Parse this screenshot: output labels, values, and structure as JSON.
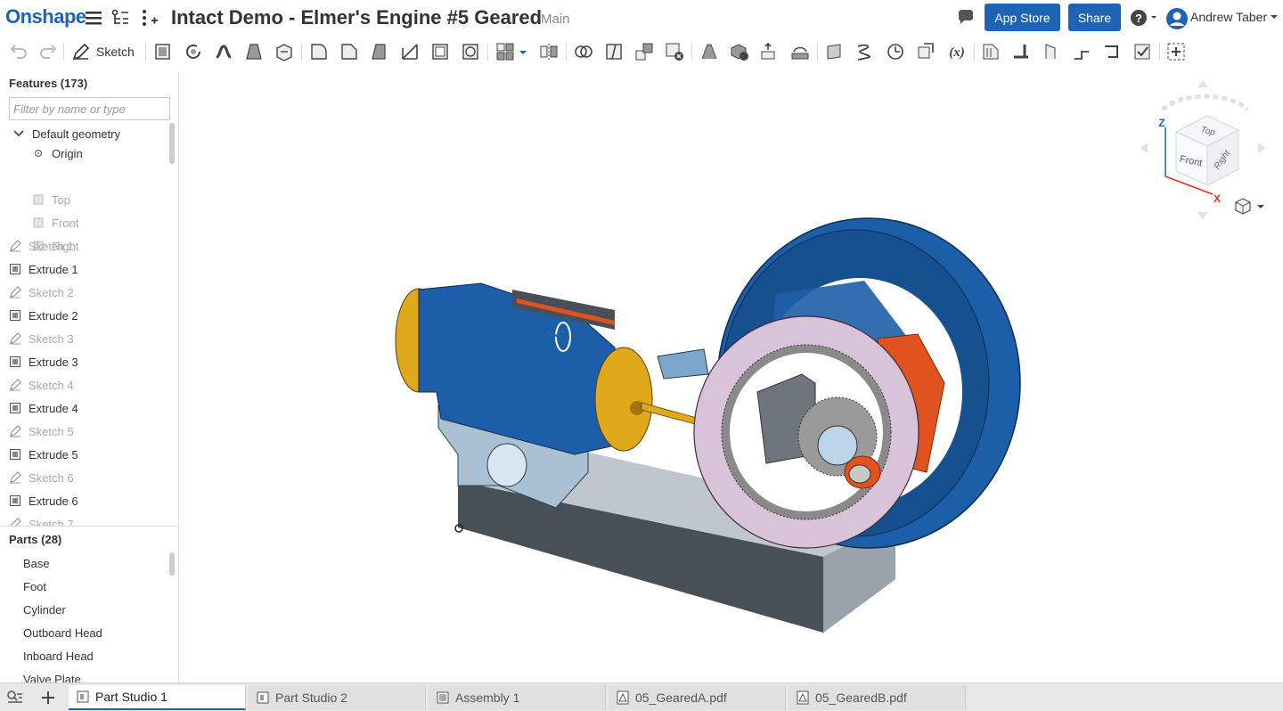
{
  "app": {
    "logo": "Onshape"
  },
  "header": {
    "title": "Intact Demo - Elmer's Engine #5 Geared",
    "branch": "Main",
    "app_store_label": "App Store",
    "share_label": "Share",
    "user_name": "Andrew Taber"
  },
  "toolbar": {
    "sketch_label": "Sketch"
  },
  "features": {
    "heading": "Features (173)",
    "filter_placeholder": "Filter by name or type",
    "items": [
      {
        "label": "Default geometry",
        "type": "group"
      },
      {
        "label": "Origin",
        "type": "origin"
      },
      {
        "label": "Top",
        "type": "plane"
      },
      {
        "label": "Front",
        "type": "plane"
      },
      {
        "label": "Right",
        "type": "plane"
      },
      {
        "label": "Sketch 1",
        "type": "sketch"
      },
      {
        "label": "Extrude 1",
        "type": "extrude"
      },
      {
        "label": "Sketch 2",
        "type": "sketch"
      },
      {
        "label": "Extrude 2",
        "type": "extrude"
      },
      {
        "label": "Sketch 3",
        "type": "sketch"
      },
      {
        "label": "Extrude 3",
        "type": "extrude"
      },
      {
        "label": "Sketch 4",
        "type": "sketch"
      },
      {
        "label": "Extrude 4",
        "type": "extrude"
      },
      {
        "label": "Sketch 5",
        "type": "sketch"
      },
      {
        "label": "Extrude 5",
        "type": "extrude"
      },
      {
        "label": "Sketch 6",
        "type": "sketch"
      },
      {
        "label": "Extrude 6",
        "type": "extrude"
      },
      {
        "label": "Sketch 7",
        "type": "sketch"
      }
    ]
  },
  "parts": {
    "heading": "Parts (28)",
    "items": [
      "Base",
      "Foot",
      "Cylinder",
      "Outboard Head",
      "Inboard Head",
      "Valve Plate"
    ]
  },
  "view_cube": {
    "top": "Top",
    "front": "Front",
    "right": "Right",
    "axis_x": "X",
    "axis_z": "Z"
  },
  "tabs": [
    {
      "label": "Part Studio 1",
      "active": true,
      "icon": "part-studio-icon"
    },
    {
      "label": "Part Studio 2",
      "active": false,
      "icon": "part-studio-icon"
    },
    {
      "label": "Assembly 1",
      "active": false,
      "icon": "assembly-icon"
    },
    {
      "label": "05_GearedA.pdf",
      "active": false,
      "icon": "pdf-icon"
    },
    {
      "label": "05_GearedB.pdf",
      "active": false,
      "icon": "pdf-icon"
    }
  ],
  "colors": {
    "accent": "#1f63b5",
    "engine_blue": "#1d5ea8",
    "brass": "#e0a91c",
    "gear_pink": "#d9c3d8",
    "base_gray": "#9aa3ab",
    "orange": "#e0531f"
  }
}
